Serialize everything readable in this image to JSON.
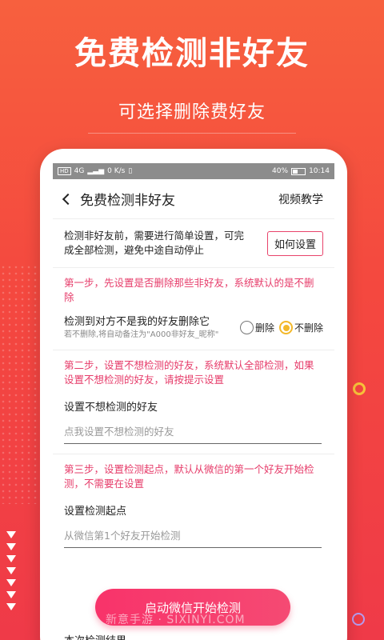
{
  "promo": {
    "title": "免费检测非好友",
    "subtitle": "可选择删除费好友"
  },
  "statusbar": {
    "left_badge": "HD",
    "network": "4G",
    "speed": "0 K/s",
    "battery": "40%",
    "time": "10:14"
  },
  "header": {
    "title": "免费检测非好友",
    "help_link": "视频教学"
  },
  "intro": {
    "text": "检测非好友前，需要进行简单设置，可完成全部检测，避免中途自动停止",
    "how_button": "如何设置"
  },
  "step1": {
    "text": "第一步，先设置是否删除那些非好友，系统默认的是不删除",
    "option_label": "检测到对方不是我的好友删除它",
    "option_note": "若不删除,将自动备注为\"A000非好友_昵称\"",
    "radio_delete": "删除",
    "radio_keep": "不删除",
    "selected": "不删除"
  },
  "step2": {
    "text": "第二步，设置不想检测的好友，系统默认全部检测，如果设置不想检测的好友，请按提示设置",
    "field_label": "设置不想检测的好友",
    "field_placeholder": "点我设置不想检测的好友"
  },
  "step3": {
    "text": "第三步，设置检测起点，默认从微信的第一个好友开始检测，不需要在设置",
    "field_label": "设置检测起点",
    "field_placeholder": "从微信第1个好友开始检测"
  },
  "actions": {
    "start_button": "启动微信开始检测",
    "result_label": "本次检测结果"
  },
  "watermark": "新意手游 · SIXINYI.COM",
  "colors": {
    "accent": "#e63c6a",
    "radio_selected": "#f3b82a",
    "background": "#f4483f"
  }
}
